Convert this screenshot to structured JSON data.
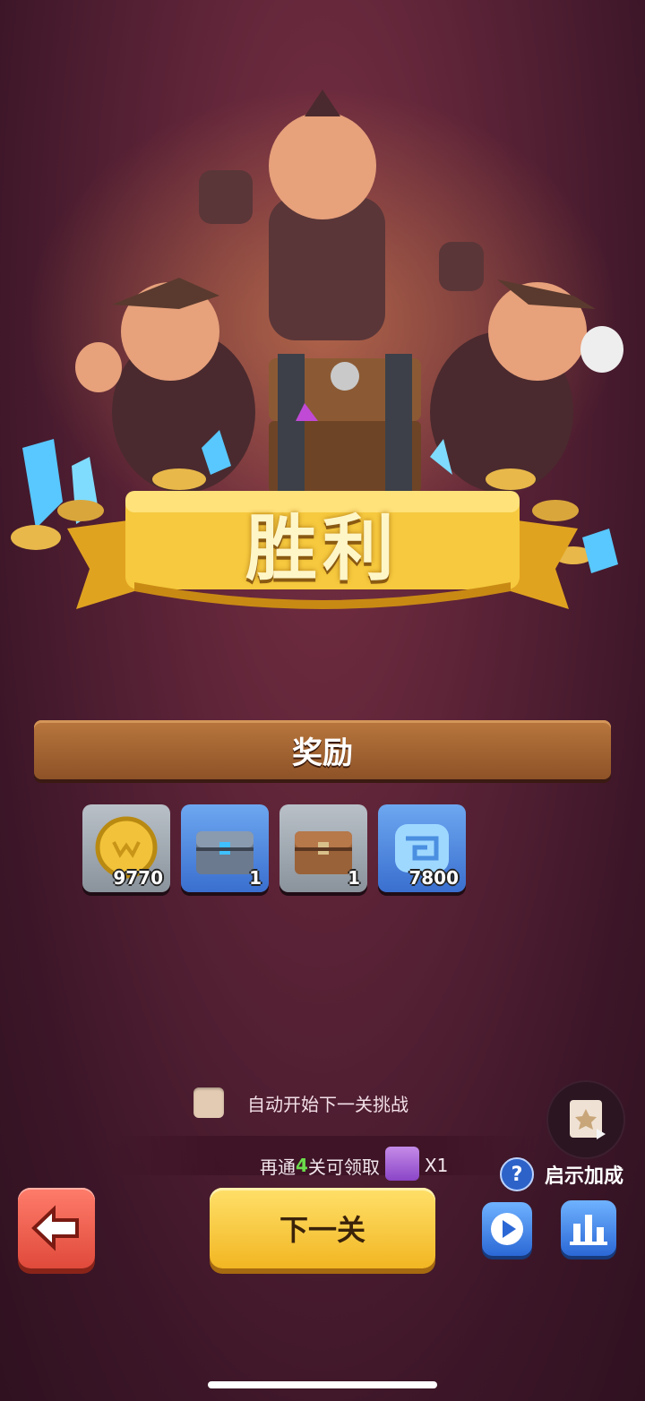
{
  "result": {
    "title": "胜利"
  },
  "rewards_section": {
    "title": "奖励",
    "items": [
      {
        "icon": "gold-coin-icon",
        "count": "9770"
      },
      {
        "icon": "iron-chest-icon",
        "count": "1"
      },
      {
        "icon": "wooden-chest-icon",
        "count": "1"
      },
      {
        "icon": "blue-gem-icon",
        "count": "7800"
      }
    ]
  },
  "auto_next": {
    "label": "自动开始下一关挑战",
    "checked": false
  },
  "progress_hint": {
    "prefix": "再通",
    "number": "4",
    "suffix": "关可领取",
    "reward_multiplier": "X1"
  },
  "hint_bonus": {
    "help_glyph": "?",
    "label": "启示加成"
  },
  "buttons": {
    "next_label": "下一关"
  },
  "colors": {
    "accent_gold": "#f2b622",
    "back_red": "#e04a3b",
    "blue": "#2b68d6",
    "progress_green": "#6bdc4c"
  }
}
